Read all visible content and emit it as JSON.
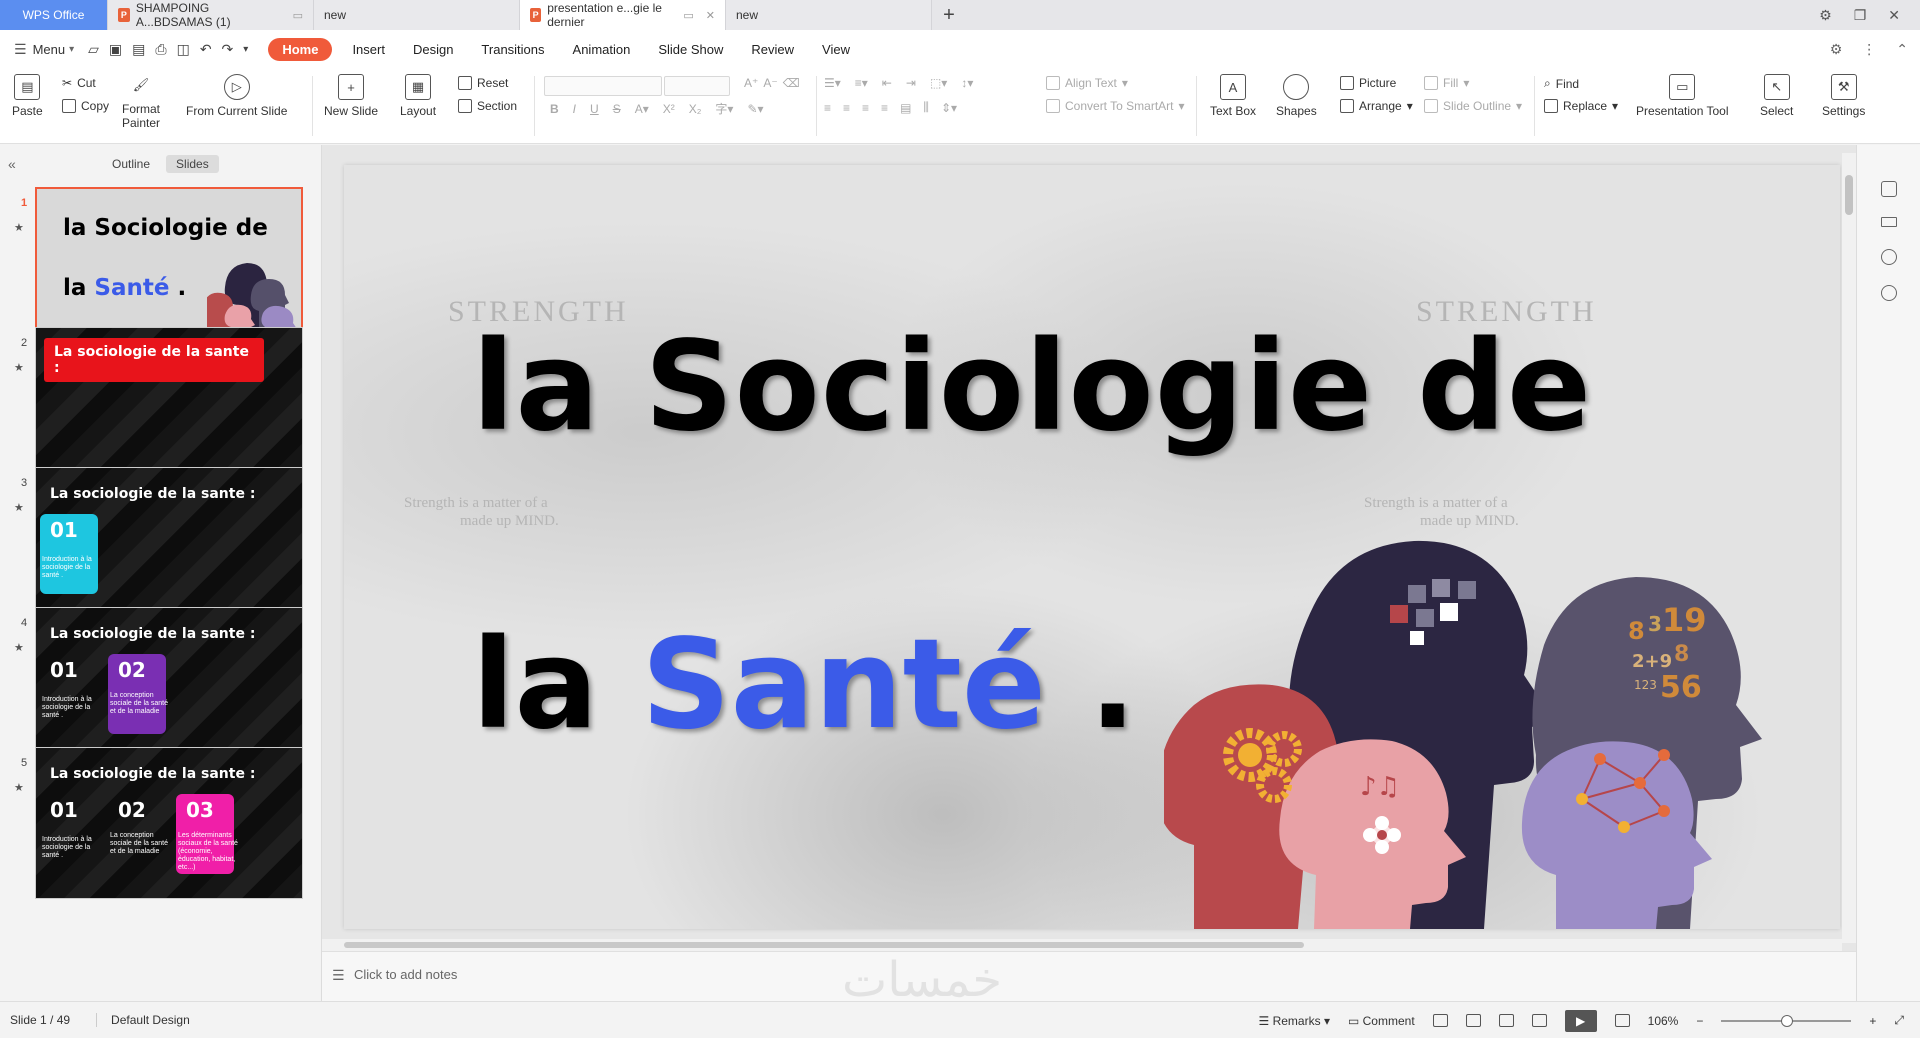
{
  "tabs": {
    "wps": "WPS Office",
    "doc1": "SHAMPOING A...BDSAMAS (1)",
    "new1": "new",
    "doc2": "presentation e...gie le dernier",
    "new2": "new"
  },
  "menu": {
    "menu_label": "Menu",
    "items": [
      "Home",
      "Insert",
      "Design",
      "Transitions",
      "Animation",
      "Slide Show",
      "Review",
      "View"
    ]
  },
  "ribbon": {
    "paste": "Paste",
    "cut": "Cut",
    "copy": "Copy",
    "format_painter_1": "Format",
    "format_painter_2": "Painter",
    "from_current_slide": "From Current Slide",
    "new_slide": "New Slide",
    "layout": "Layout",
    "reset": "Reset",
    "section": "Section",
    "align_text": "Align Text",
    "convert_smartart": "Convert To SmartArt",
    "text_box": "Text Box",
    "shapes": "Shapes",
    "picture": "Picture",
    "arrange": "Arrange",
    "fill": "Fill",
    "slide_outline": "Slide Outline",
    "find": "Find",
    "replace": "Replace",
    "presentation_tool": "Presentation Tool",
    "select": "Select",
    "settings": "Settings"
  },
  "left_panel": {
    "outline_tab": "Outline",
    "slides_tab": "Slides",
    "thumbs": [
      {
        "num": "1",
        "line1": "la Sociologie de",
        "line2a": "la ",
        "line2b": "Santé",
        "line2c": " ."
      },
      {
        "num": "2",
        "header": "La sociologie de la sante :"
      },
      {
        "num": "3",
        "header": "La sociologie de la sante :",
        "n1": "01",
        "s1": "Introduction à la sociologie de la santé ."
      },
      {
        "num": "4",
        "header": "La sociologie de la sante :",
        "n1": "01",
        "s1": "Introduction à la sociologie de la santé .",
        "n2": "02",
        "s2": "La conception sociale de la santé et de la maladie"
      },
      {
        "num": "5",
        "header": "La sociologie de la sante :",
        "n1": "01",
        "s1": "Introduction à la sociologie de la santé .",
        "n2": "02",
        "s2": "La conception sociale de la santé et de la maladie",
        "n3": "03",
        "s3": "Les déterminants sociaux de la santé (économie, éducation, habitat, etc...)"
      }
    ]
  },
  "slide": {
    "title_line1": "la Sociologie de",
    "title_line2a": "la ",
    "title_line2b": "Santé",
    "title_line2c": " .",
    "bg_strength": "STRENGTH",
    "bg_quote1": "Strength is a matter of a",
    "bg_quote2": "made up MIND."
  },
  "notes": {
    "placeholder": "Click to add notes",
    "watermark": "خمسات"
  },
  "status": {
    "slide_counter": "Slide 1 / 49",
    "design": "Default Design",
    "remarks": "Remarks",
    "comment": "Comment",
    "zoom": "106%"
  },
  "colors": {
    "accent": "#f05a3a",
    "title_blue": "#3b5be8",
    "tab_blue": "#5b8ef0"
  }
}
